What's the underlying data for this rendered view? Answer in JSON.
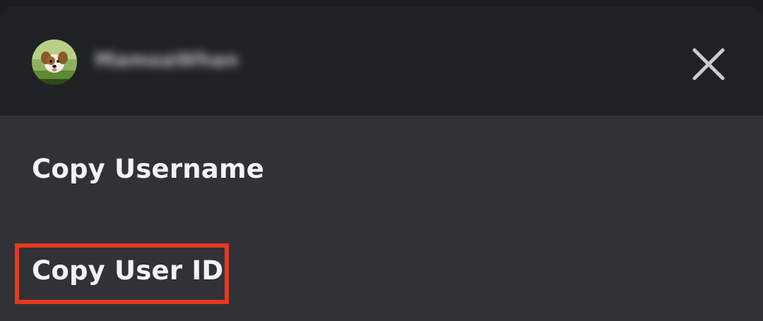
{
  "header": {
    "username": "MamoaWhan",
    "avatar_icon": "dog-avatar-icon",
    "close_icon": "close-icon"
  },
  "menu": {
    "items": [
      {
        "label": "Copy Username"
      },
      {
        "label": "Copy User ID"
      }
    ]
  },
  "highlight": {
    "color": "#e8391f",
    "target": "Copy User ID"
  },
  "colors": {
    "header_bg": "#202124",
    "menu_bg": "#313237",
    "text": "#f2f3f5"
  }
}
